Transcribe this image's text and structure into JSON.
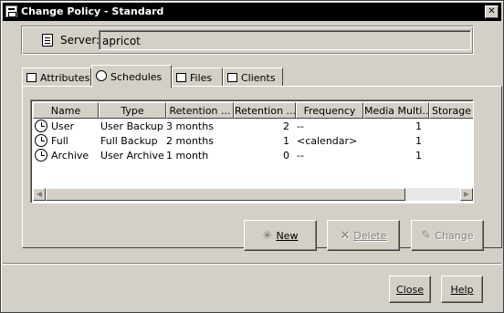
{
  "window": {
    "title": "Change Policy - Standard",
    "close_glyph": "✕"
  },
  "server": {
    "label": "Server:",
    "value": "apricot"
  },
  "tabs": [
    {
      "label": "Attributes"
    },
    {
      "label": "Schedules"
    },
    {
      "label": "Files"
    },
    {
      "label": "Clients"
    }
  ],
  "table": {
    "columns": [
      "Name",
      "Type",
      "Retention ...",
      "Retention ...",
      "Frequency",
      "Media Multi...",
      "Storage Ur"
    ],
    "rows": [
      {
        "name": "User",
        "type": "User Backup",
        "retention1": "3 months",
        "retention2": "2",
        "frequency": "--",
        "media": "1"
      },
      {
        "name": "Full",
        "type": "Full Backup",
        "retention1": "2 months",
        "retention2": "1",
        "frequency": "<calendar>",
        "media": "1"
      },
      {
        "name": "Archive",
        "type": "User Archive",
        "retention1": "1 month",
        "retention2": "0",
        "frequency": "--",
        "media": "1"
      }
    ]
  },
  "buttons": {
    "new_label": "New",
    "delete_label": "Delete",
    "change_label": "Change",
    "close_label": "Close",
    "help_label": "Help"
  }
}
